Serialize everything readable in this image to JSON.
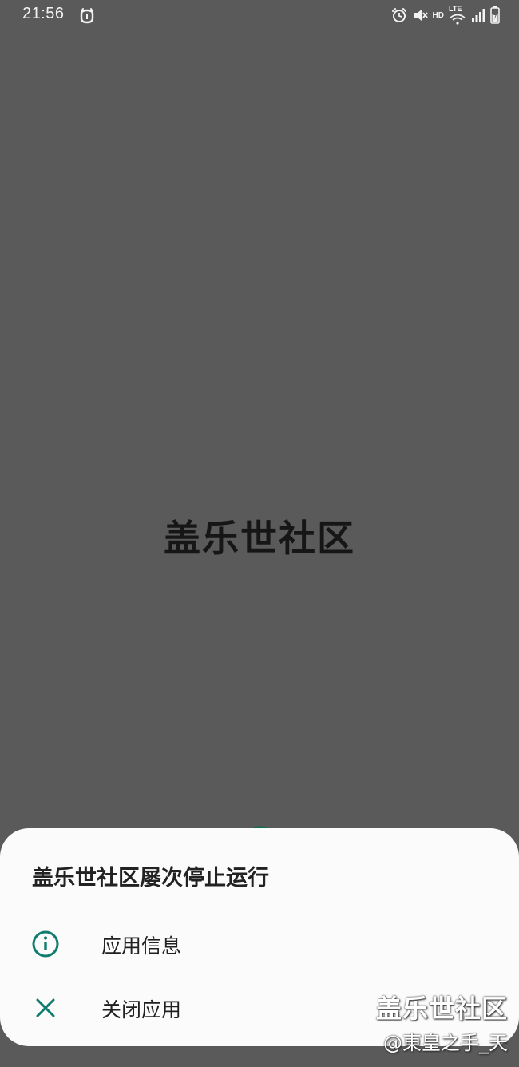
{
  "status_bar": {
    "time": "21:56",
    "network_label": "HD",
    "lte_label": "LTE",
    "icons": [
      "android-debug-icon",
      "alarm-icon",
      "mute-icon",
      "wifi-icon",
      "signal-icon",
      "battery-charging-icon"
    ]
  },
  "splash": {
    "app_name": "盖乐世社区"
  },
  "dialog": {
    "title": "盖乐世社区屡次停止运行",
    "items": [
      {
        "label": "应用信息",
        "icon": "info-icon"
      },
      {
        "label": "关闭应用",
        "icon": "close-icon"
      }
    ]
  },
  "watermark": {
    "title": "盖乐世社区",
    "author": "@東皇之手_天"
  },
  "colors": {
    "background": "#5a5a5a",
    "sheet": "#fbfbfb",
    "accent": "#0e7d6f"
  }
}
